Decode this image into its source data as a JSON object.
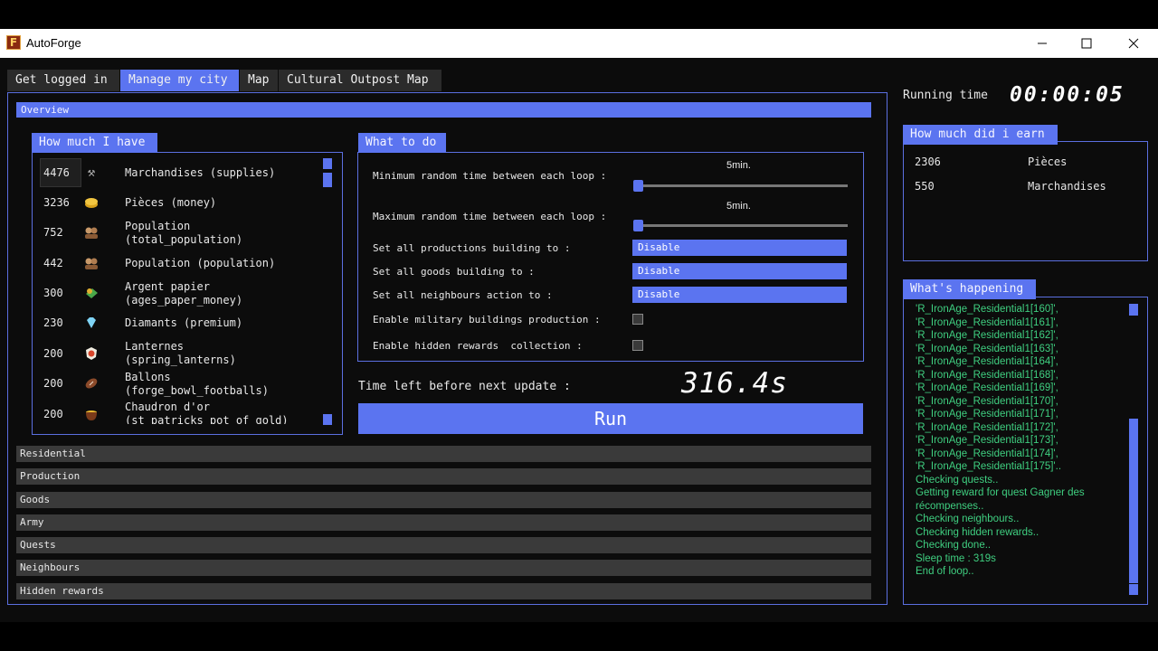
{
  "window": {
    "title": "AutoForge"
  },
  "tabs": [
    "Get logged in",
    "Manage my city",
    "Map",
    "Cultural Outpost Map"
  ],
  "overview_label": "Overview",
  "have": {
    "header": "How much I have",
    "items": [
      {
        "count": "4476",
        "icon": "hammer-icon",
        "name": "Marchandises (supplies)"
      },
      {
        "count": "3236",
        "icon": "coins-icon",
        "name": "Pièces (money)"
      },
      {
        "count": "752",
        "icon": "population-icon",
        "name": "Population\n(total_population)"
      },
      {
        "count": "442",
        "icon": "population-icon",
        "name": "Population (population)"
      },
      {
        "count": "300",
        "icon": "paper-money-icon",
        "name": "Argent papier\n(ages_paper_money)"
      },
      {
        "count": "230",
        "icon": "diamond-icon",
        "name": "Diamants (premium)"
      },
      {
        "count": "200",
        "icon": "lantern-icon",
        "name": "Lanternes\n(spring_lanterns)"
      },
      {
        "count": "200",
        "icon": "football-icon",
        "name": "Ballons\n(forge_bowl_footballs)"
      },
      {
        "count": "200",
        "icon": "gold-pot-icon",
        "name": "Chaudron d'or\n(st patricks pot of gold)"
      }
    ]
  },
  "todo": {
    "header": "What to do",
    "min_label": "Minimum random time between each loop :",
    "min_value": "5min.",
    "max_label": "Maximum random time between each loop :",
    "max_value": "5min.",
    "productions_label": "Set all productions building to :",
    "productions_value": "Disable",
    "goods_label": "Set all goods building to :",
    "goods_value": "Disable",
    "neighbours_label": "Set all neighbours action to :",
    "neighbours_value": "Disable",
    "military_label": "Enable military buildings production :",
    "hidden_label": "Enable hidden rewards  collection :"
  },
  "time_left_label": "Time left before next update :",
  "time_left_value": "316.4s",
  "run_label": "Run",
  "sections": [
    "Residential",
    "Production",
    "Goods",
    "Army",
    "Quests",
    "Neighbours",
    "Hidden rewards"
  ],
  "running_time_label": "Running time",
  "running_time_value": "00:00:05",
  "earn": {
    "header": "How much did i earn",
    "items": [
      {
        "value": "2306",
        "name": "Pièces"
      },
      {
        "value": "550",
        "name": "Marchandises"
      }
    ]
  },
  "happening": {
    "header": "What's happening",
    "lines": [
      "'R_IronAge_Residential1[160]',",
      "'R_IronAge_Residential1[161]',",
      "'R_IronAge_Residential1[162]',",
      "'R_IronAge_Residential1[163]',",
      "'R_IronAge_Residential1[164]',",
      "'R_IronAge_Residential1[168]',",
      "'R_IronAge_Residential1[169]',",
      "'R_IronAge_Residential1[170]',",
      "'R_IronAge_Residential1[171]',",
      "'R_IronAge_Residential1[172]',",
      "'R_IronAge_Residential1[173]',",
      "'R_IronAge_Residential1[174]',",
      "'R_IronAge_Residential1[175]'..",
      "Checking quests..",
      "Getting reward for quest Gagner des",
      "récompenses..",
      "Checking neighbours..",
      "Checking hidden rewards..",
      "Checking done..",
      "Sleep time : 319s",
      "End of loop.."
    ]
  },
  "colors": {
    "accent": "#5b74f0",
    "log_text": "#3fcf80",
    "background": "#0c0c0c"
  }
}
